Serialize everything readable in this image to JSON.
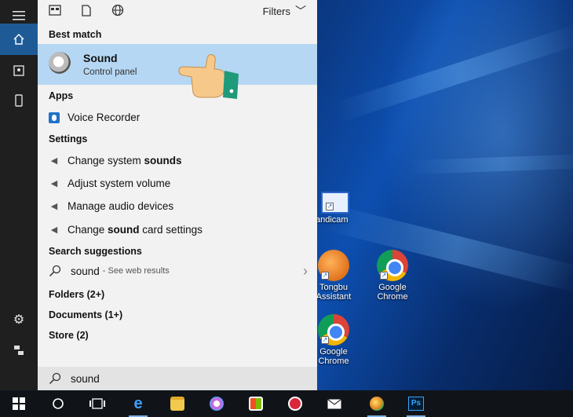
{
  "filters_label": "Filters",
  "sections": {
    "best_match": "Best match",
    "apps": "Apps",
    "settings": "Settings",
    "search_suggestions": "Search suggestions",
    "folders": "Folders (2+)",
    "documents": "Documents (1+)",
    "store": "Store (2)"
  },
  "best_match": {
    "title": "Sound",
    "subtitle": "Control panel"
  },
  "apps": [
    {
      "label": "Voice Recorder"
    }
  ],
  "settings": [
    {
      "pre": "Change system ",
      "bold": "sounds",
      "post": ""
    },
    {
      "pre": "Adjust system volume",
      "bold": "",
      "post": ""
    },
    {
      "pre": "Manage audio devices",
      "bold": "",
      "post": ""
    },
    {
      "pre": "Change ",
      "bold": "sound",
      "post": " card settings"
    }
  ],
  "suggestion": {
    "query": "sound",
    "hint": "- See web results"
  },
  "search_input": {
    "value": "sound"
  },
  "desktop_icons": {
    "bandicam": "andicam",
    "tongbu_line1": "Tongbu",
    "tongbu_line2": "Assistant",
    "chrome1_line1": "Google",
    "chrome1_line2": "Chrome",
    "chrome2_line1": "Google",
    "chrome2_line2": "Chrome"
  },
  "taskbar": {
    "photoshop": "Ps"
  },
  "colors": {
    "accent": "#1e5b96",
    "highlight": "#b5d7f3",
    "panel": "#f2f2f2",
    "rail": "#1f1f1f"
  }
}
